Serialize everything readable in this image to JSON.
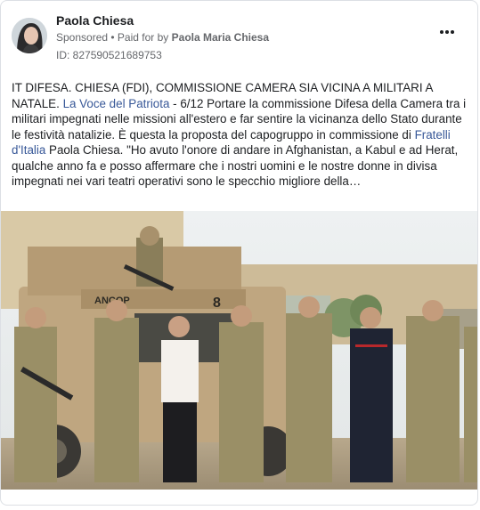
{
  "post": {
    "author": "Paola Chiesa",
    "sponsored": "Sponsored",
    "paid_prefix": "• Paid for by",
    "paid_by": "Paola Maria Chiesa",
    "id_line": "ID: 827590521689753",
    "more_icon": "more-options-icon",
    "body": {
      "p1": "IT DIFESA. CHIESA (FDI), COMMISSIONE CAMERA SIA VICINA A MILITARI A NATALE.",
      "link1": "La Voce del Patriota",
      "p2": "- 6/12 Portare la commissione Difesa della Camera tra i militari impegnati nelle missioni all'estero e far sentire la vicinanza dello Stato durante le festività natalizie. È questa la proposta del capogruppo in commissione di",
      "link2": "Fratelli d'Italia",
      "p3": "Paola Chiesa. \"Ho avuto l'onore di andare in Afghanistan, a Kabul e ad Herat, qualche anno fa e posso affermare che i nostri uomini e le nostre donne in divisa impegnati nei vari teatri operativi sono le specchio migliore della…"
    },
    "photo": {
      "vehicle_plate": "ANCOP",
      "vehicle_number": "8"
    },
    "colors": {
      "link": "#385898",
      "text": "#1c1e21",
      "muted": "#65676b"
    }
  }
}
